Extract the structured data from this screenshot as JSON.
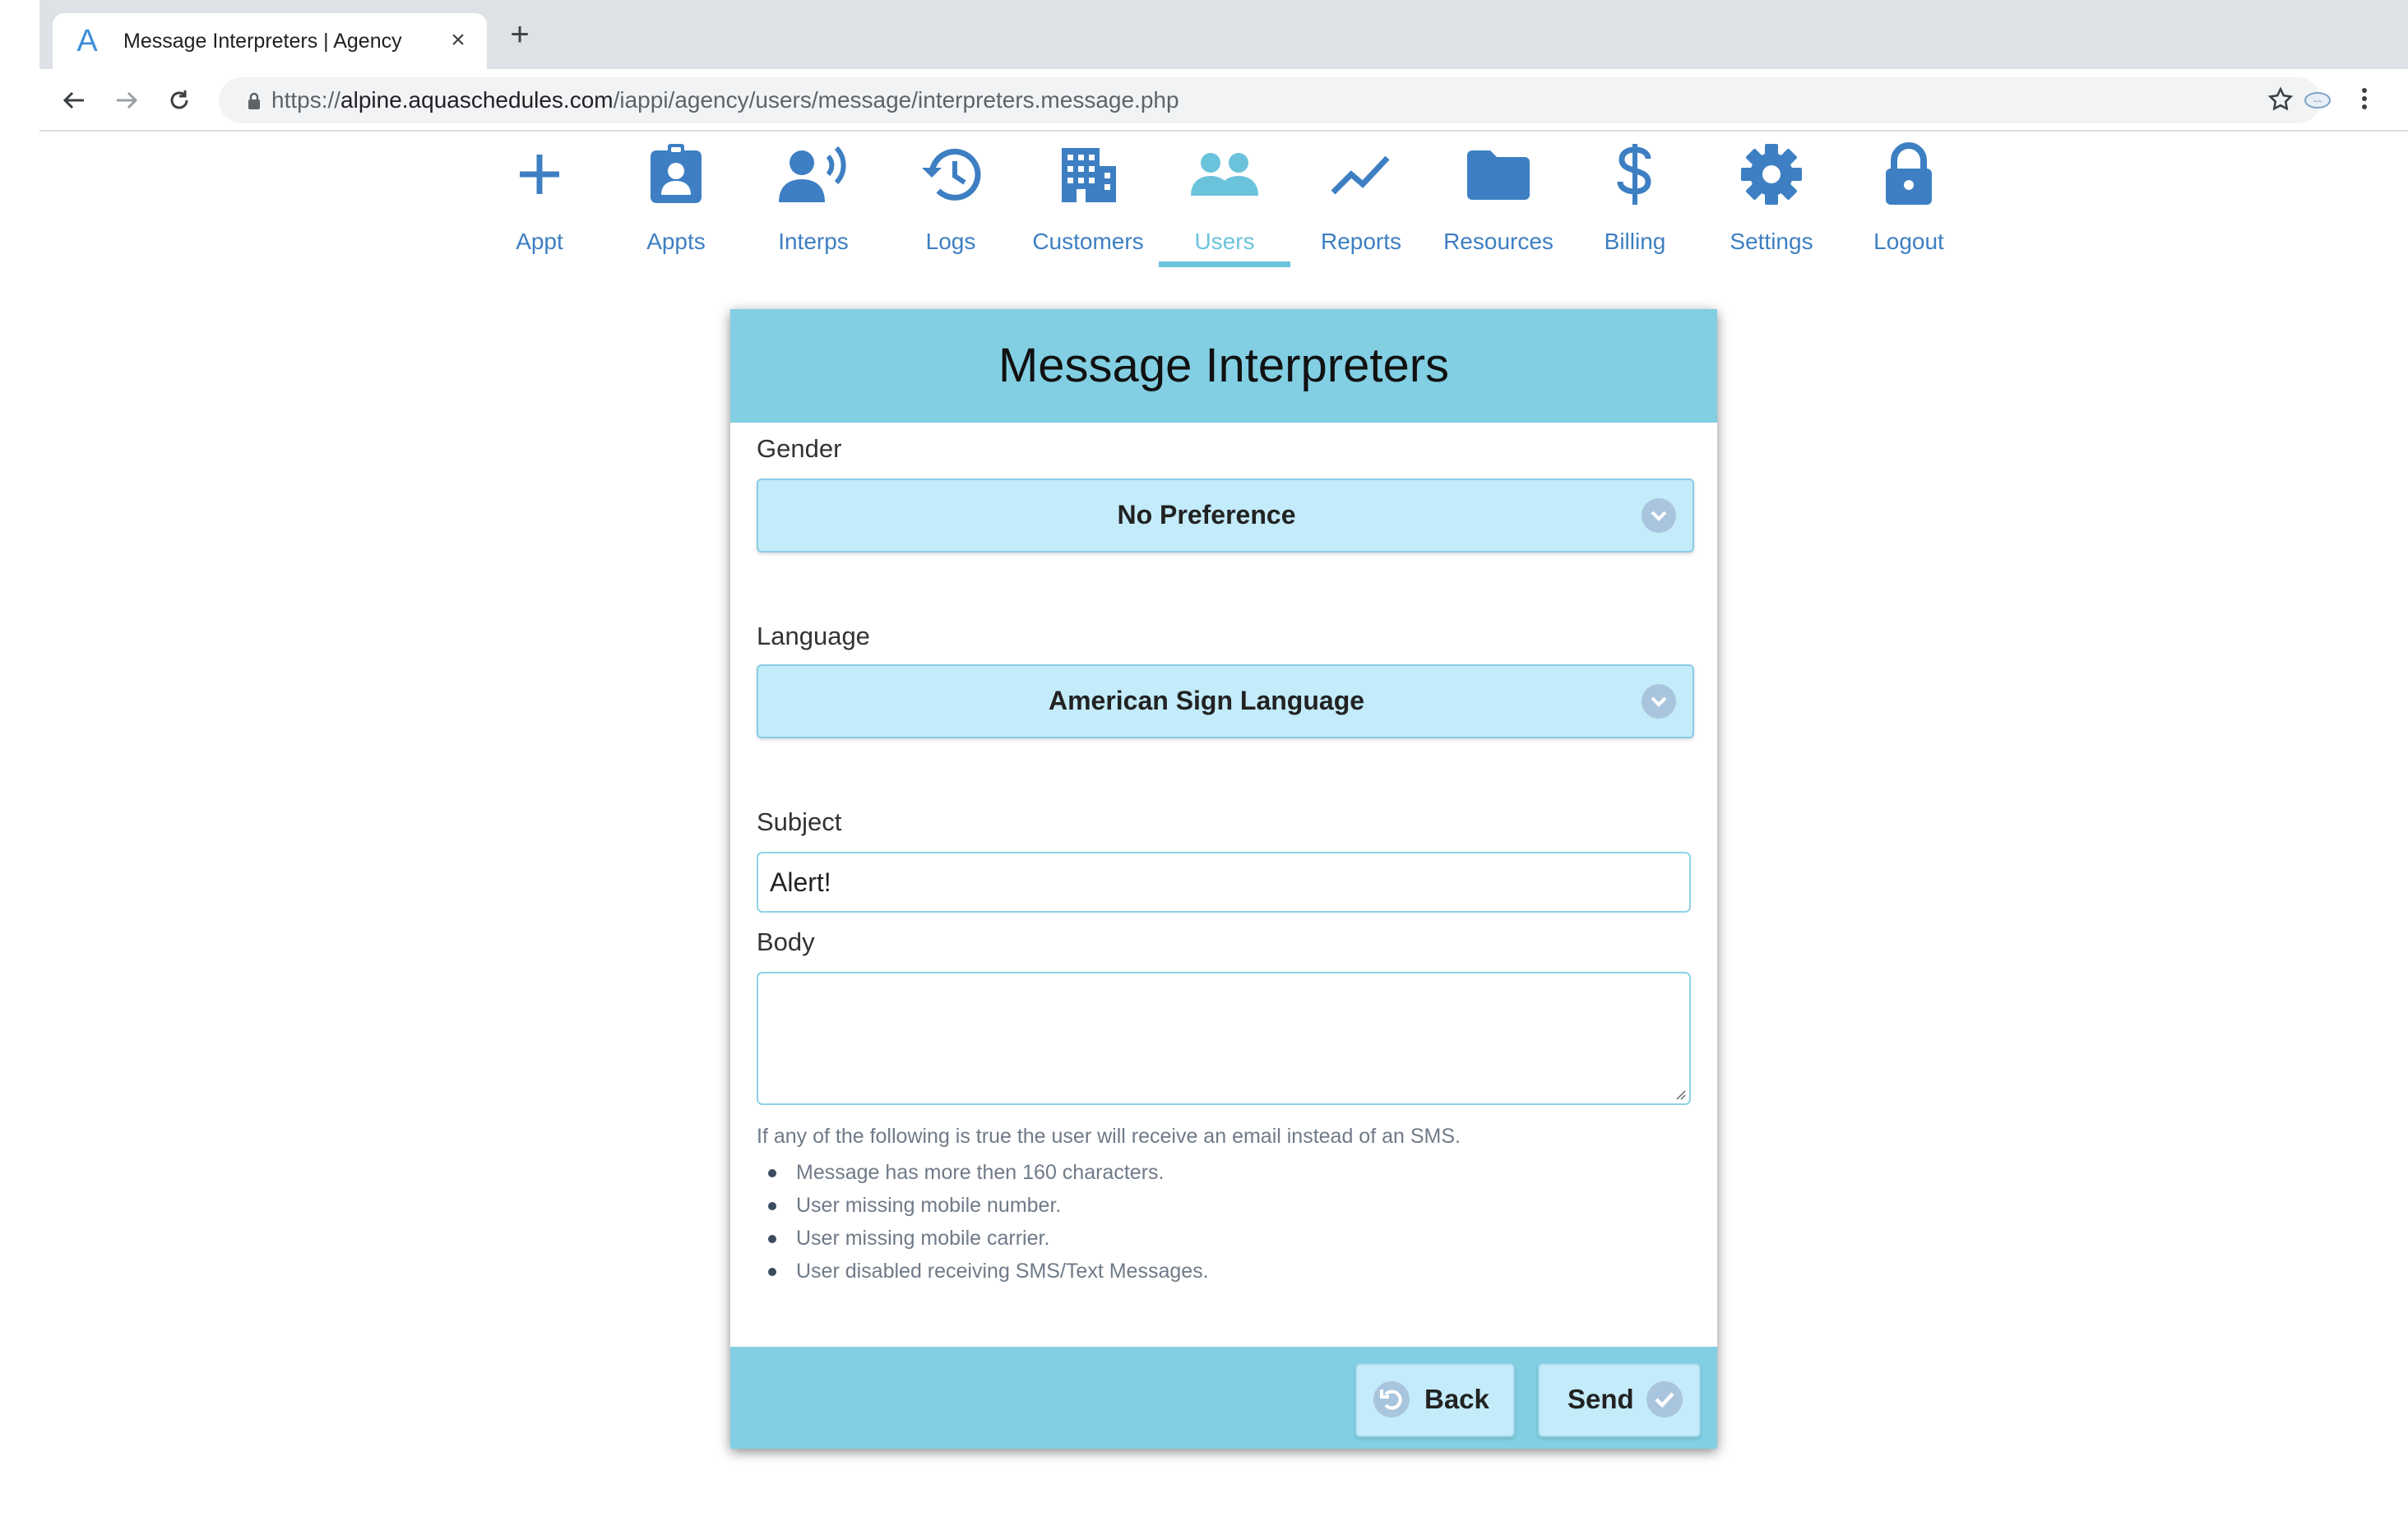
{
  "browser": {
    "tab_title": "Message Interpreters | Agency",
    "url_scheme": "https://",
    "url_host": "alpine.aquaschedules.com",
    "url_path": "/iappi/agency/users/message/interpreters.message.php"
  },
  "nav": {
    "items": [
      {
        "label": "Appt",
        "icon": "plus-icon"
      },
      {
        "label": "Appts",
        "icon": "id-badge-icon"
      },
      {
        "label": "Interps",
        "icon": "speaking-person-icon"
      },
      {
        "label": "Logs",
        "icon": "history-icon"
      },
      {
        "label": "Customers",
        "icon": "building-icon"
      },
      {
        "label": "Users",
        "icon": "users-icon",
        "active": true
      },
      {
        "label": "Reports",
        "icon": "trend-line-icon"
      },
      {
        "label": "Resources",
        "icon": "folder-icon"
      },
      {
        "label": "Billing",
        "icon": "dollar-icon"
      },
      {
        "label": "Settings",
        "icon": "gear-icon"
      },
      {
        "label": "Logout",
        "icon": "lock-icon"
      }
    ],
    "active_color": "#6bc3db",
    "color": "#3d7fc2"
  },
  "form": {
    "title": "Message Interpreters",
    "gender_label": "Gender",
    "gender_value": "No Preference",
    "language_label": "Language",
    "language_value": "American Sign Language",
    "subject_label": "Subject",
    "subject_value": "Alert!",
    "body_label": "Body",
    "body_value": "",
    "note": "If any of the following is true the user will receive an email instead of an SMS.",
    "conditions": [
      "Message has more then 160 characters.",
      "User missing mobile number.",
      "User missing mobile carrier.",
      "User disabled receiving SMS/Text Messages."
    ],
    "back_label": "Back",
    "send_label": "Send"
  },
  "colors": {
    "header": "#82cfe3",
    "select_bg": "#c3ebfa",
    "nav_blue": "#3d7fc2"
  }
}
